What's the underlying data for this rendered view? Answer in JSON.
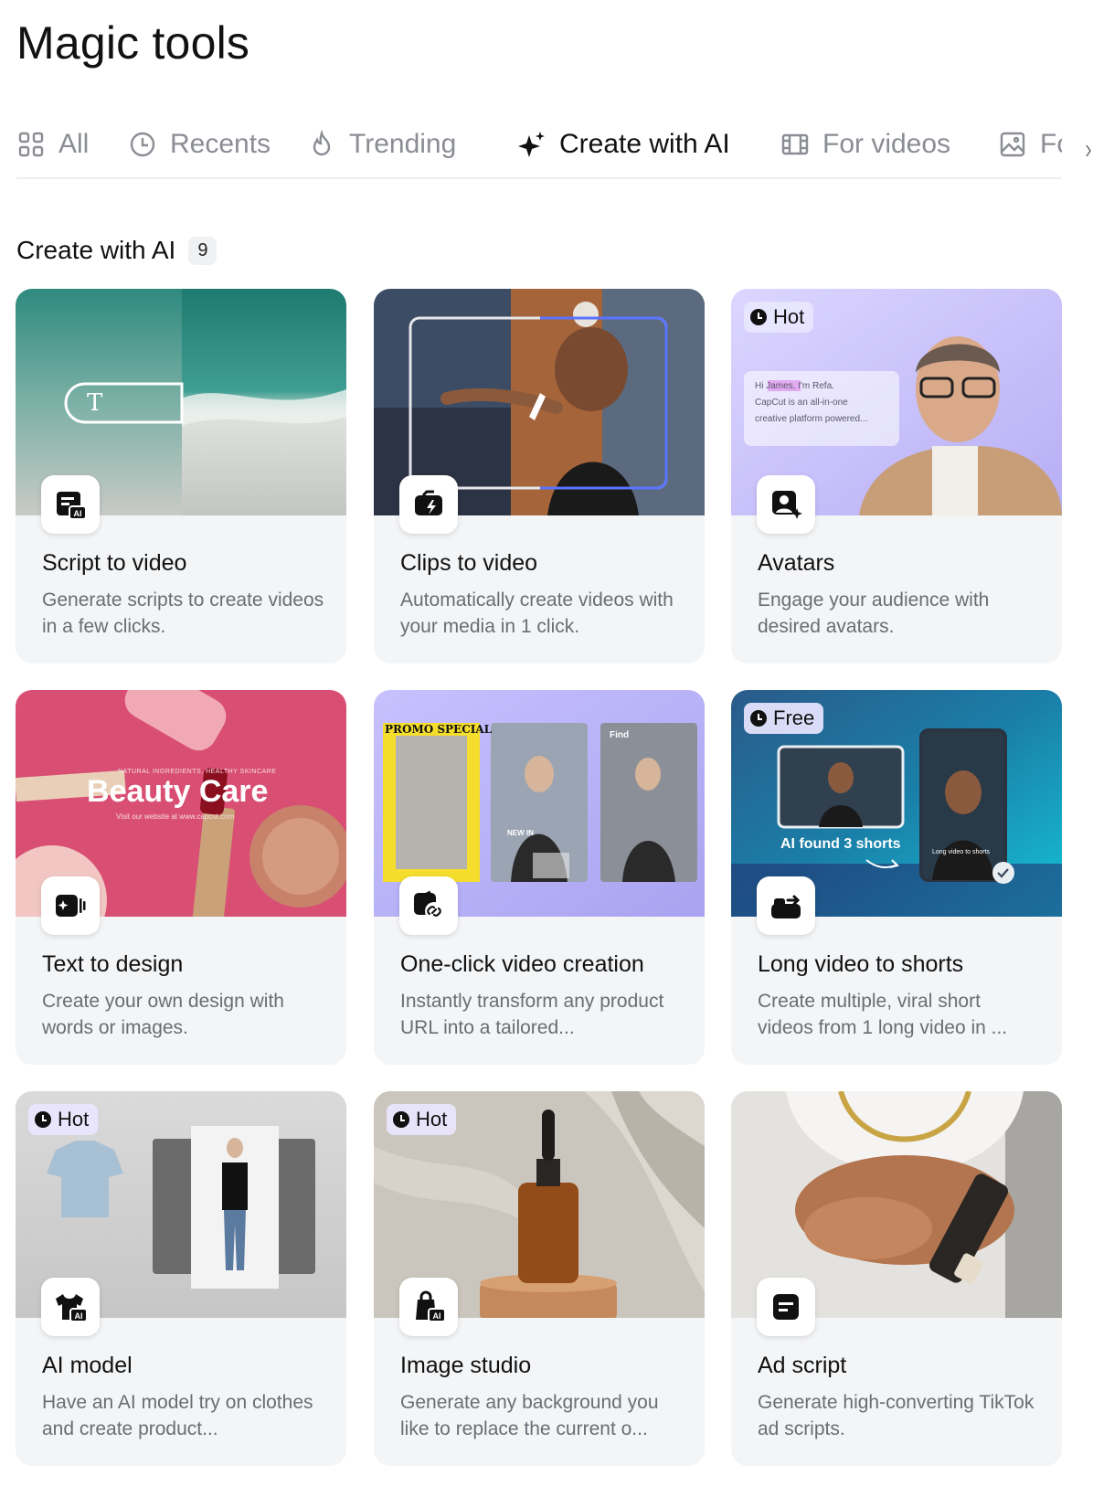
{
  "page": {
    "title": "Magic tools"
  },
  "tabs": [
    {
      "label": "All",
      "icon": "grid-icon"
    },
    {
      "label": "Recents",
      "icon": "clock-icon"
    },
    {
      "label": "Trending",
      "icon": "flame-icon"
    },
    {
      "label": "Create with AI",
      "icon": "sparkle-icon",
      "active": true
    },
    {
      "label": "For videos",
      "icon": "film-icon"
    },
    {
      "label": "Fo",
      "icon": "image-icon"
    }
  ],
  "section": {
    "title": "Create with AI",
    "count": "9"
  },
  "colors": {
    "accent": "#17c3d6",
    "badge_bg": "#e9e6ff",
    "card_bg": "#f4f5f7"
  },
  "cards": [
    {
      "title": "Script to video",
      "desc": "Generate scripts to create videos in a few clicks.",
      "icon": "script-ai-icon",
      "thumb_text": "T"
    },
    {
      "title": "Clips to video",
      "desc": "Automatically create videos with your media in 1 click.",
      "icon": "clips-flash-icon"
    },
    {
      "title": "Avatars",
      "desc": "Engage your audience with desired avatars.",
      "icon": "avatar-sparkle-icon",
      "badge": "Hot",
      "thumb_text": {
        "line1": "Hi James, I'm Refa.",
        "line2": "CapCut is an all-in-one",
        "line3": "creative platform powered..."
      }
    },
    {
      "title": "Text to design",
      "desc": "Create your own design with words or images.",
      "icon": "text-design-icon",
      "thumb_text": {
        "small_top": "NATURAL INGREDIENTS, HEALTHY SKINCARE",
        "headline": "Beauty Care",
        "small_bottom": "Visit our website at www.capcut.com"
      }
    },
    {
      "title": "One-click video creation",
      "desc": "Instantly transform any product URL into a tailored...",
      "icon": "link-video-icon",
      "thumb_text": {
        "promo": "PROMO SPECIAL",
        "new_in": "NEW IN",
        "find": "Find"
      }
    },
    {
      "title": "Long video to shorts",
      "desc": "Create multiple, viral short videos from 1 long video in ...",
      "icon": "convert-shorts-icon",
      "badge": "Free",
      "thumb_text": {
        "found": "AI found 3 shorts",
        "long": "Long video to shorts"
      }
    },
    {
      "title": "AI model",
      "desc": "Have an AI model try on clothes and create product...",
      "icon": "shirt-ai-icon",
      "badge": "Hot"
    },
    {
      "title": "Image studio",
      "desc": "Generate any background you like to replace the current o...",
      "icon": "bag-ai-icon",
      "badge": "Hot"
    },
    {
      "title": "Ad script",
      "desc": "Generate high-converting TikTok ad scripts.",
      "icon": "ad-script-icon"
    }
  ]
}
